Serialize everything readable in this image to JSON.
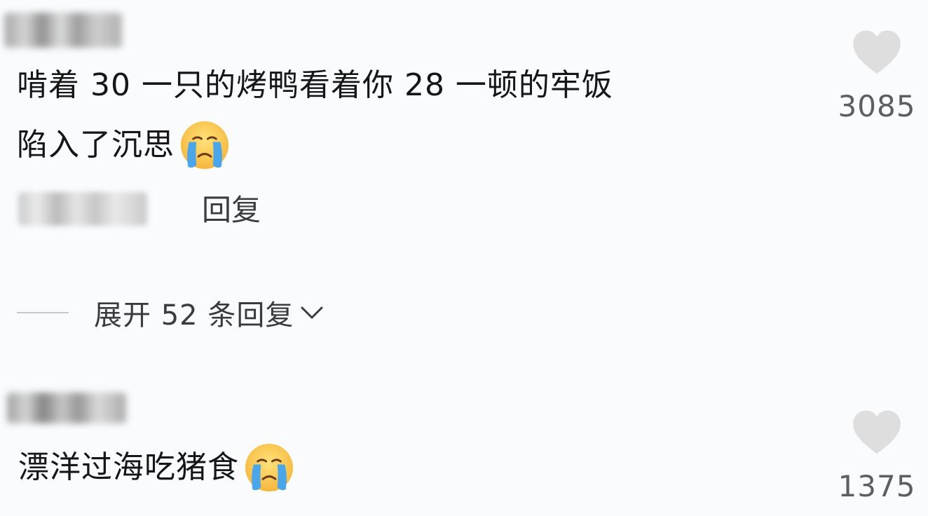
{
  "comments": [
    {
      "text_line1": "啃着 30 一只的烤鸭看着你 28 一顿的牢饭",
      "text_line2": "陷入了沉思",
      "emoji": "crying-face",
      "reply_label": "回复",
      "like_count": "3085",
      "expand": {
        "label": "展开 52 条回复"
      }
    },
    {
      "text_line1": "漂洋过海吃猪食",
      "emoji": "crying-face",
      "like_count": "1375"
    }
  ],
  "colors": {
    "background": "#fafbfd",
    "text": "#161616",
    "secondary_text": "#3b3b3b",
    "heart": "#dedede",
    "like_count": "#5e5e5e"
  }
}
